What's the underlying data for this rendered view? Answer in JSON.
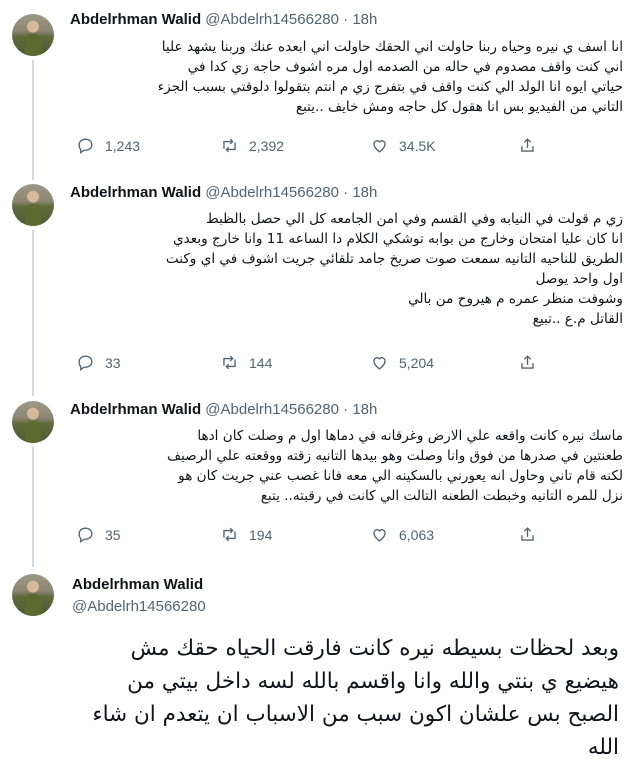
{
  "author": {
    "name": "Abdelrhman Walid",
    "handle": "@Abdelrh14566280",
    "dot": "·"
  },
  "tweets": [
    {
      "time": "18h",
      "lines": [
        "انا اسف ي نيره وحياه ربنا حاولت اني الحقك حاولت اني ابعده عنك وربنا يشهد عليا",
        "اني كنت واقف مصدوم في حاله من الصدمه اول مره اشوف حاجه زي كدا في",
        "حياتي ايوه انا الولد الي كنت واقف في بتفرج زي م انتم بتقولوا دلوقتي بسبب الجزء",
        "التاني من الفيديو بس انا هقول كل حاجه ومش خايف ..يتبع"
      ],
      "replies": "",
      "retweets": "2,392",
      "likes": "34.5K",
      "views": "1,243"
    },
    {
      "time": "18h",
      "lines": [
        "زي م قولت في النيابه وفي القسم وفي امن الجامعه كل الي حصل بالظبط",
        "انا كان عليا امتحان وخارج من بوابه توشكي الكلام دا الساعه 11 وانا خارج وبعدي",
        "الطريق للناحيه التانيه سمعت صوت صريخ جامد تلقائي جريت اشوف في اي وكنت",
        "اول واحد يوصل",
        "وشوفت منظر عمره م هيروح من بالي",
        "القاتل م.ع ..تبيع"
      ],
      "replies": "33",
      "retweets": "144",
      "likes": "5,204"
    },
    {
      "time": "18h",
      "lines": [
        "ماسك نيره كانت واقعه علي الارض وغرقانه في دماها اول م وصلت كان ادها",
        "طعنتين في صدرها من فوق وانا وصلت وهو بيدها التانيه زقته ووقعته علي الرصيف",
        "لكنه قام تاني وحاول انه يعورني بالسكينه الي معه فانا غصب عني جريت كان هو",
        "نزل للمره التانيه وخبطت الطعنه التالت الي كانت في رقبته.. يتبع"
      ],
      "replies": "35",
      "retweets": "194",
      "likes": "6,063"
    }
  ],
  "main_tweet": {
    "lines": [
      "وبعد لحظات بسيطه نيره كانت فارقت الحياه حقك مش",
      "هيضيع ي بنتي والله وانا واقسم بالله لسه داخل بيتي من",
      "الصبح بس علشان اكون سبب من الاسباب ان يتعدم ان شاء",
      "الله"
    ]
  },
  "icons": {
    "reply": "reply-icon",
    "retweet": "retweet-icon",
    "like": "heart-icon",
    "share": "share-icon"
  }
}
